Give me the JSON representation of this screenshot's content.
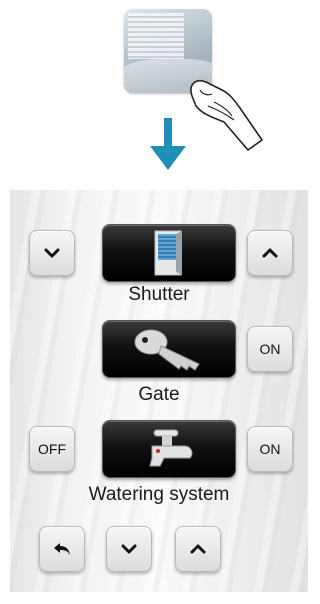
{
  "panel": {
    "devices": [
      {
        "label": "Shutter",
        "left_button": "",
        "right_button": ""
      },
      {
        "label": "Gate",
        "right_button": "ON"
      },
      {
        "label": "Watering system",
        "left_button": "OFF",
        "right_button": "ON"
      }
    ]
  },
  "icons": {
    "illustration": "bedroom-photo-icon",
    "finger": "tap-finger-icon",
    "arrow": "arrow-down-icon",
    "shutter": "window-shutter-icon",
    "gate": "key-icon",
    "watering": "faucet-icon",
    "back": "back-arrow-icon",
    "down": "chevron-down-icon",
    "up": "chevron-up-icon"
  },
  "colors": {
    "accent_arrow": "#1f8fb8",
    "device_bg": "#000000",
    "button_bg": "#e6e6e6"
  }
}
